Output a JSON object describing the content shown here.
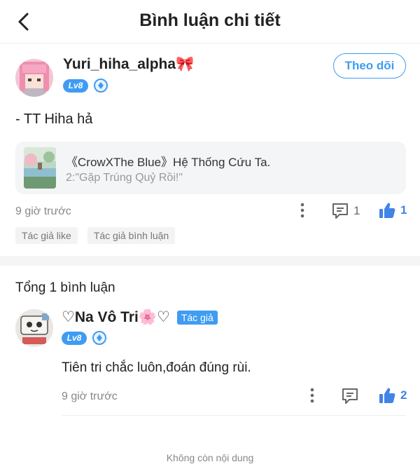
{
  "header": {
    "title": "Bình luận chi tiết"
  },
  "post": {
    "username": "Yuri_hiha_alpha🎀",
    "level": "Lv8",
    "follow_label": "Theo dõi",
    "text": "- TT Hiha hả",
    "book": {
      "title": "《CrowXThe Blue》Hệ Thống Cứu Ta.",
      "chapter": "2:\"Gặp Trúng Quỷ Rồi!\""
    },
    "time": "9 giờ trước",
    "reply_count": "1",
    "like_count": "1",
    "tags": [
      "Tác giả like",
      "Tác giả bình luận"
    ]
  },
  "comments_total": "Tổng 1 bình luận",
  "comment": {
    "username": "♡Na Vô Tri🌸♡",
    "author_badge": "Tác giả",
    "level": "Lv8",
    "text": "Tiên tri chắc luôn,đoán đúng rùi.",
    "time": "9 giờ trước",
    "like_count": "2"
  },
  "footer": {
    "end_text": "Không còn nội dung"
  },
  "colors": {
    "accent": "#3f9cf2",
    "like": "#3f84e6",
    "muted": "#888888"
  },
  "icons": {
    "back": "chevron-left-icon",
    "more": "more-vertical-icon",
    "reply": "comment-icon",
    "like": "thumbs-up-icon",
    "gem": "diamond-icon"
  }
}
